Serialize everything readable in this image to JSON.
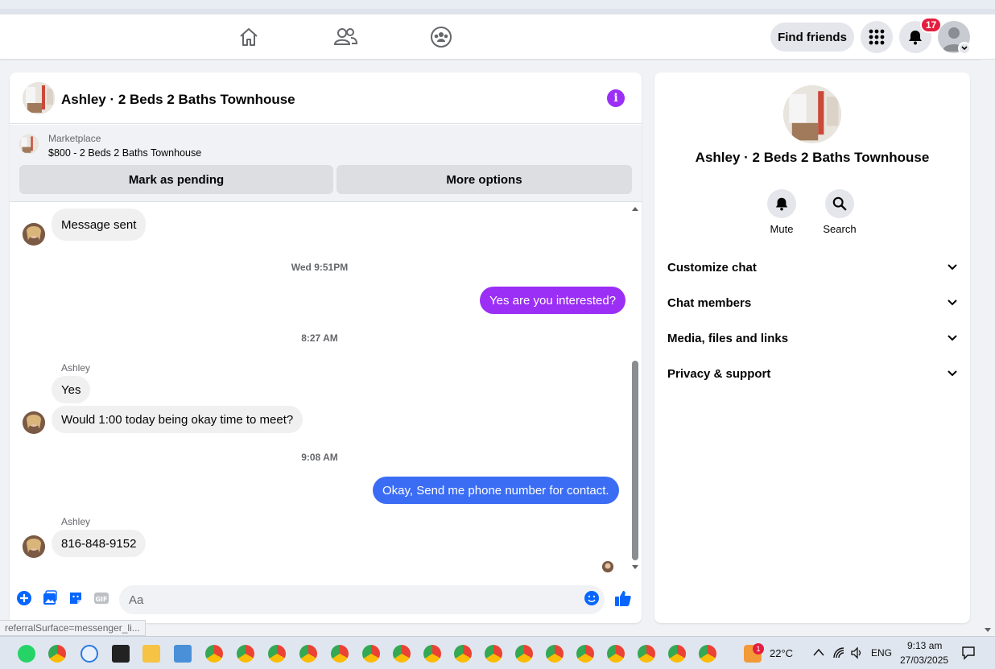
{
  "browser": {
    "status_url": "referralSurface=messenger_li..."
  },
  "topnav": {
    "icons": [
      "home-icon",
      "friends-icon",
      "groups-icon"
    ],
    "find_friends": "Find friends",
    "notification_count": "17"
  },
  "chat": {
    "title": "Ashley · 2 Beds 2 Baths Townhouse",
    "marketplace_label": "Marketplace",
    "listing": "$800 - 2 Beds 2 Baths Townhouse",
    "mark_pending": "Mark as pending",
    "more_options": "More options",
    "messages": {
      "m1": "Message sent",
      "ts1": "Wed 9:51PM",
      "m2": "Yes are you interested?",
      "ts2": "8:27 AM",
      "sender1": "Ashley",
      "m3": "Yes",
      "m4": "Would 1:00 today being okay time to meet?",
      "ts3": "9:08 AM",
      "m5": "Okay,  Send me phone number for contact.",
      "sender2": "Ashley",
      "m6": "816-848-9152"
    },
    "composer_placeholder": "Aa",
    "colors": {
      "accent_purple": "#9b2ff5",
      "bubble_blue": "#3b6cf4"
    }
  },
  "right_panel": {
    "title": "Ashley · 2 Beds 2 Baths Townhouse",
    "mute": "Mute",
    "search": "Search",
    "sections": [
      "Customize chat",
      "Chat members",
      "Media, files and links",
      "Privacy & support"
    ]
  },
  "taskbar": {
    "weather": "22°C",
    "language": "ENG",
    "time": "9:13 am",
    "date": "27/03/2025",
    "weather_badge": "1"
  }
}
